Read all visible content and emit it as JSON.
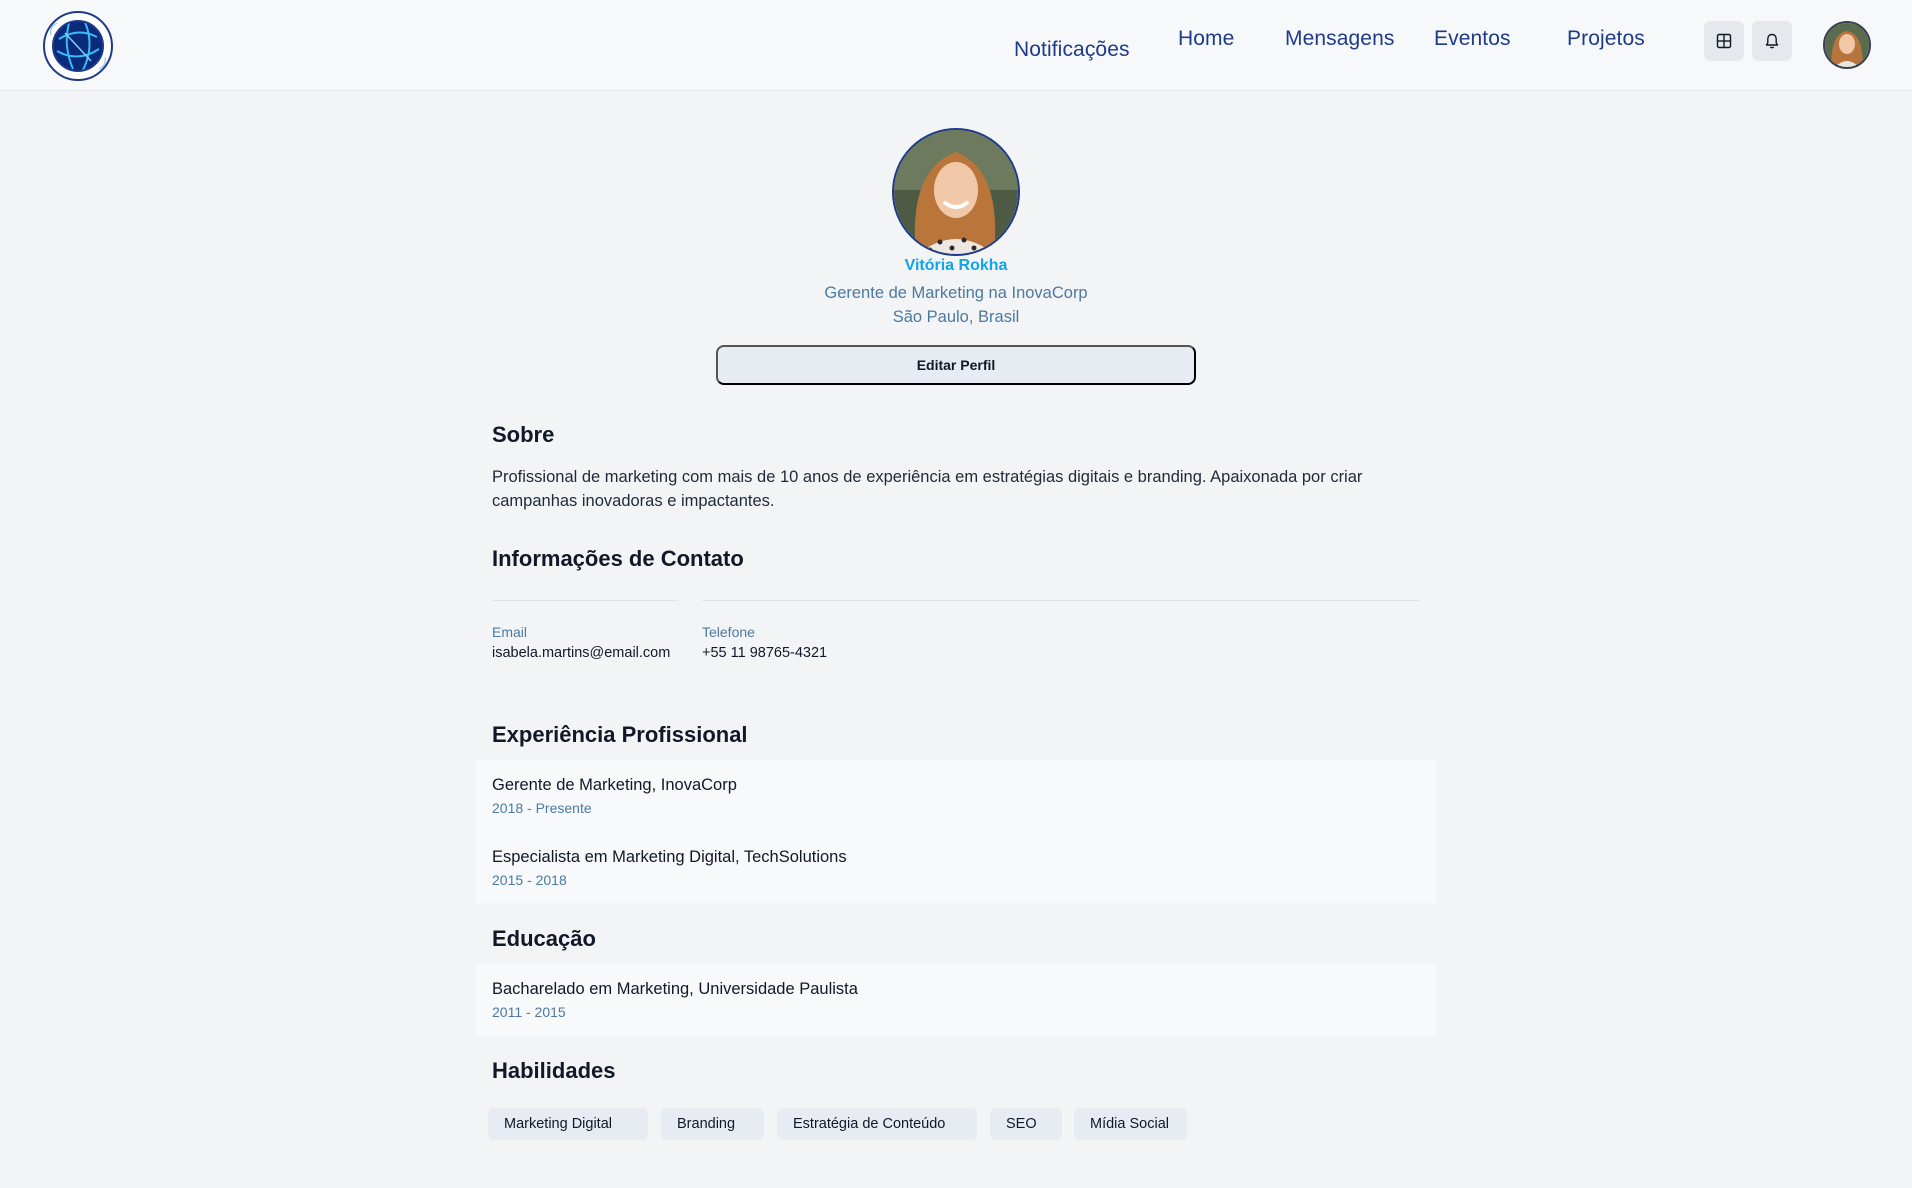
{
  "header": {
    "nav": [
      "Notificações",
      "Home",
      "Mensagens",
      "Eventos",
      "Projetos"
    ],
    "icons": [
      "grid-icon",
      "bell-icon"
    ]
  },
  "profile": {
    "name": "Vitória Rokha",
    "role": "Gerente de Marketing na InovaCorp",
    "location": "São Paulo, Brasil",
    "edit_label": "Editar Perfil"
  },
  "about": {
    "title": "Sobre",
    "text": "Profissional de marketing com mais de 10 anos de experiência em estratégias digitais e branding. Apaixonada por criar campanhas inovadoras e impactantes."
  },
  "contact": {
    "title": "Informações de Contato",
    "email_label": "Email",
    "email": "isabela.martins@email.com",
    "phone_label": "Telefone",
    "phone": "+55 11 98765-4321"
  },
  "experience": {
    "title": "Experiência Profissional",
    "items": [
      {
        "title": "Gerente de Marketing, InovaCorp",
        "dates": "2018 - Presente"
      },
      {
        "title": "Especialista em Marketing Digital, TechSolutions",
        "dates": "2015 - 2018"
      }
    ]
  },
  "education": {
    "title": "Educação",
    "items": [
      {
        "title": "Bacharelado em Marketing, Universidade Paulista",
        "dates": "2011 - 2015"
      }
    ]
  },
  "skills": {
    "title": "Habilidades",
    "items": [
      "Marketing Digital",
      "Branding",
      "Estratégia de Conteúdo",
      "SEO",
      "Mídia Social"
    ]
  },
  "colors": {
    "accent": "#0ea5e9",
    "nav": "#1e3a8a",
    "muted": "#4b79a1"
  }
}
